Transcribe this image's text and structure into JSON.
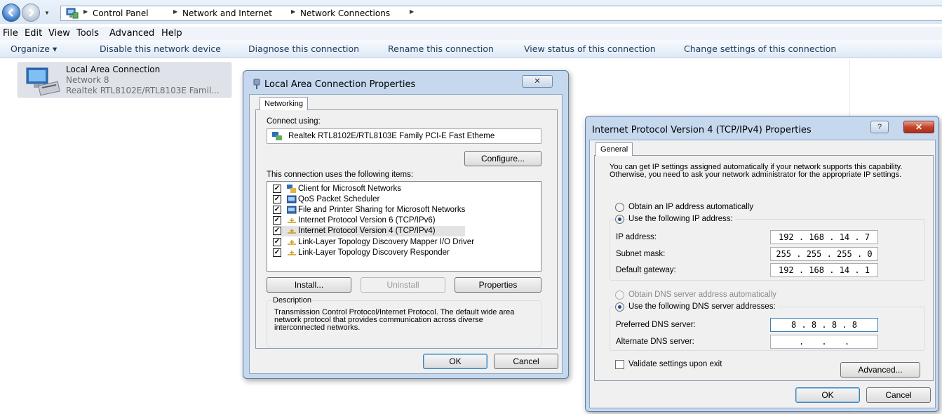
{
  "breadcrumb": [
    "Control Panel",
    "Network and Internet",
    "Network Connections"
  ],
  "menu": [
    "File",
    "Edit",
    "View",
    "Tools",
    "Advanced",
    "Help"
  ],
  "commands": {
    "organize": "Organize ▾",
    "disable": "Disable this network device",
    "diagnose": "Diagnose this connection",
    "rename": "Rename this connection",
    "view_status": "View status of this connection",
    "change_settings": "Change settings of this connection"
  },
  "connection": {
    "name": "Local Area Connection",
    "network": "Network 8",
    "adapter": "Realtek RTL8102E/RTL8103E Famil..."
  },
  "props_dialog": {
    "title": "Local Area Connection Properties",
    "close": "✕",
    "tab": "Networking",
    "connect_using_label": "Connect using:",
    "adapter": "Realtek RTL8102E/RTL8103E Family PCI-E Fast Etheme",
    "configure": "Configure...",
    "items_label": "This connection uses the following items:",
    "items": [
      {
        "label": "Client for Microsoft Networks",
        "checked": true,
        "icon": "network-client-icon"
      },
      {
        "label": "QoS Packet Scheduler",
        "checked": true,
        "icon": "service-icon"
      },
      {
        "label": "File and Printer Sharing for Microsoft Networks",
        "checked": true,
        "icon": "service-icon"
      },
      {
        "label": "Internet Protocol Version 6 (TCP/IPv6)",
        "checked": true,
        "icon": "protocol-icon"
      },
      {
        "label": "Internet Protocol Version 4 (TCP/IPv4)",
        "checked": true,
        "icon": "protocol-icon"
      },
      {
        "label": "Link-Layer Topology Discovery Mapper I/O Driver",
        "checked": true,
        "icon": "protocol-icon"
      },
      {
        "label": "Link-Layer Topology Discovery Responder",
        "checked": true,
        "icon": "protocol-icon"
      }
    ],
    "install": "Install...",
    "uninstall": "Uninstall",
    "properties": "Properties",
    "description_label": "Description",
    "description": "Transmission Control Protocol/Internet Protocol. The default wide area network protocol that provides communication across diverse interconnected networks.",
    "ok": "OK",
    "cancel": "Cancel"
  },
  "ipv4_dialog": {
    "title": "Internet Protocol Version 4 (TCP/IPv4) Properties",
    "help": "?",
    "close": "✕",
    "tab": "General",
    "intro": "You can get IP settings assigned automatically if your network supports this capability. Otherwise, you need to ask your network administrator for the appropriate IP settings.",
    "obtain_ip_auto": "Obtain an IP address automatically",
    "use_following_ip": "Use the following IP address:",
    "ip_label": "IP address:",
    "ip_value": "192 . 168 . 14 . 7",
    "mask_label": "Subnet mask:",
    "mask_value": "255 . 255 . 255 . 0",
    "gateway_label": "Default gateway:",
    "gateway_value": "192 . 168 . 14 . 1",
    "obtain_dns_auto": "Obtain DNS server address automatically",
    "use_following_dns": "Use the following DNS server addresses:",
    "pref_dns_label": "Preferred DNS server:",
    "pref_dns_value": "8 . 8 . 8 . 8",
    "alt_dns_label": "Alternate DNS server:",
    "alt_dns_value": ". . .",
    "validate": "Validate settings upon exit",
    "advanced": "Advanced...",
    "ok": "OK",
    "cancel": "Cancel"
  }
}
